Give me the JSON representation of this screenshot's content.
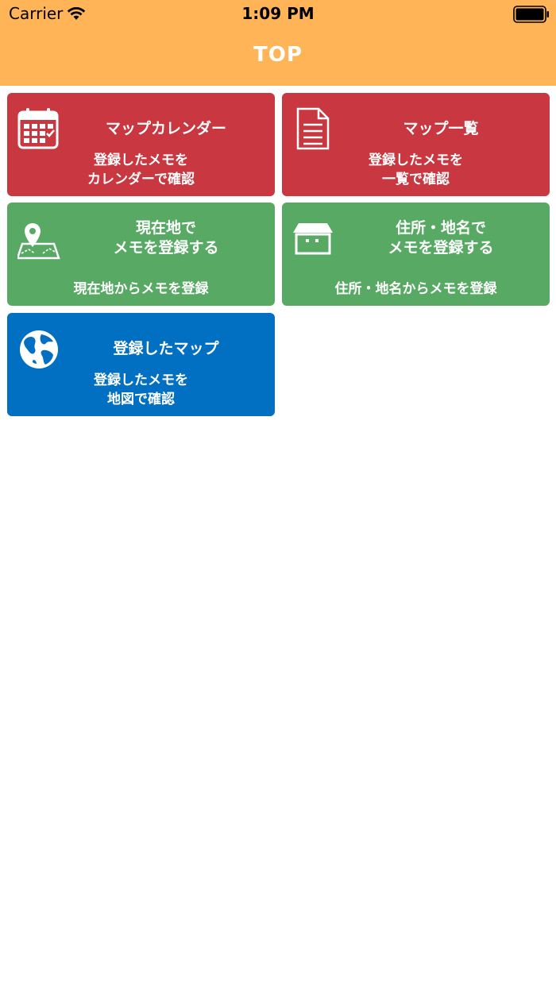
{
  "status_bar": {
    "carrier": "Carrier",
    "time": "1:09 PM"
  },
  "nav": {
    "title": "TOP"
  },
  "tiles": [
    {
      "title": "マップカレンダー",
      "description": "登録したメモを\nカレンダーで確認",
      "icon": "calendar-icon",
      "color": "#c93740"
    },
    {
      "title": "マップ一覧",
      "description": "登録したメモを\n一覧で確認",
      "icon": "document-icon",
      "color": "#c93740"
    },
    {
      "title": "現在地で\nメモを登録する",
      "description": "現在地からメモを登録",
      "icon": "map-pin-icon",
      "color": "#58a964"
    },
    {
      "title": "住所・地名で\nメモを登録する",
      "description": "住所・地名からメモを登録",
      "icon": "shop-icon",
      "color": "#58a964"
    },
    {
      "title": "登録したマップ",
      "description": "登録したメモを\n地図で確認",
      "icon": "globe-icon",
      "color": "#0170c2"
    }
  ],
  "colors": {
    "header": "#ffb458",
    "text_on_tile": "#ffffff"
  }
}
